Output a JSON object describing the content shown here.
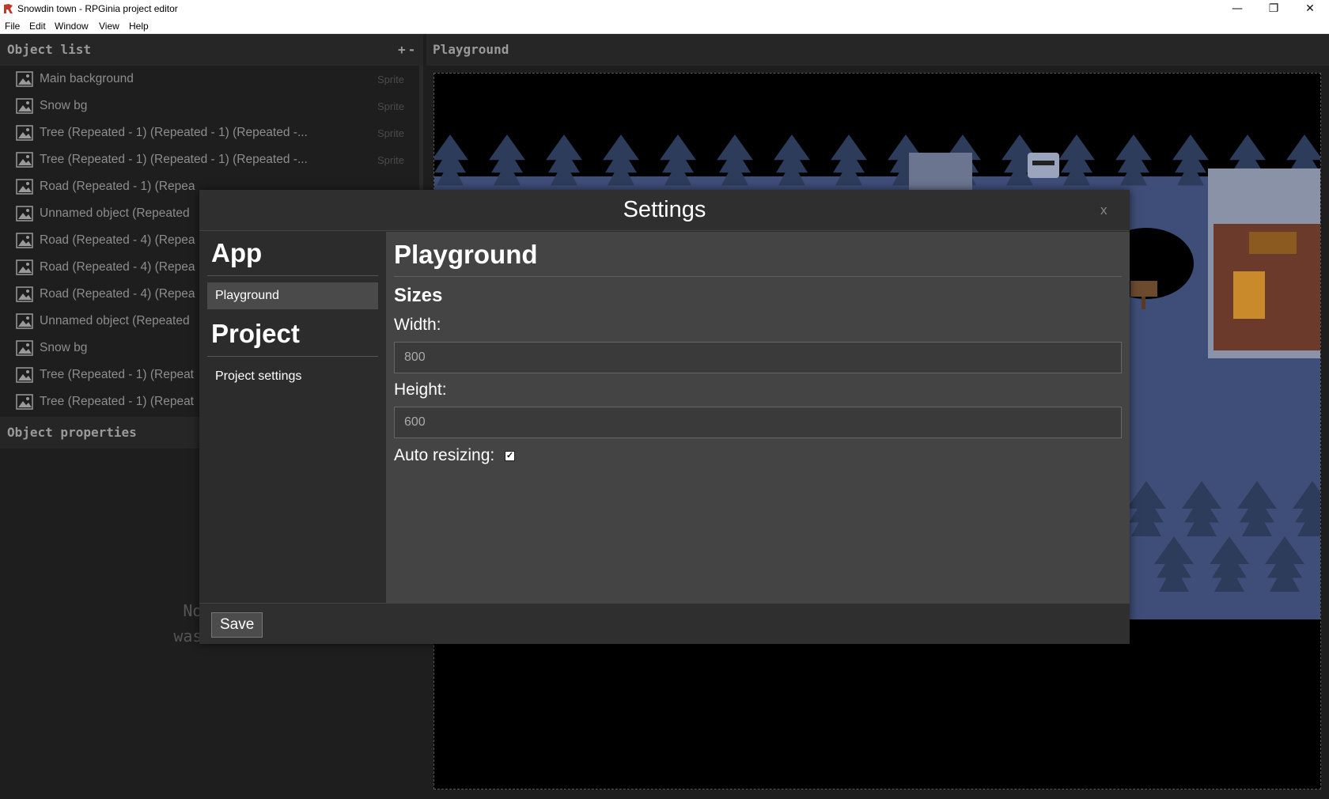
{
  "window": {
    "title": "Snowdin town - RPGinia project editor",
    "minimize_glyph": "—",
    "restore_glyph": "❐",
    "close_glyph": "✕"
  },
  "menubar": {
    "items": [
      "File",
      "Edit",
      "Window",
      "View",
      "Help"
    ]
  },
  "object_list": {
    "title": "Object list",
    "add_label": "+",
    "remove_label": "-",
    "items": [
      {
        "name": "Main background",
        "type": "Sprite"
      },
      {
        "name": "Snow bg",
        "type": "Sprite"
      },
      {
        "name": "Tree (Repeated - 1) (Repeated - 1) (Repeated -...",
        "type": "Sprite"
      },
      {
        "name": "Tree (Repeated - 1) (Repeated - 1) (Repeated -...",
        "type": "Sprite"
      },
      {
        "name": "Road (Repeated - 1) (Repea",
        "type": ""
      },
      {
        "name": "Unnamed object (Repeated",
        "type": ""
      },
      {
        "name": "Road (Repeated - 4) (Repea",
        "type": ""
      },
      {
        "name": "Road (Repeated - 4) (Repea",
        "type": ""
      },
      {
        "name": "Road (Repeated - 4) (Repea",
        "type": ""
      },
      {
        "name": "Unnamed object (Repeated",
        "type": ""
      },
      {
        "name": "Snow bg",
        "type": ""
      },
      {
        "name": "Tree (Repeated - 1) (Repeat",
        "type": ""
      },
      {
        "name": "Tree (Repeated - 1) (Repeat",
        "type": ""
      }
    ]
  },
  "object_properties": {
    "title": "Object properties",
    "empty_line1": "No one",
    "empty_line2": "wasn't t"
  },
  "playground": {
    "title": "Playground"
  },
  "settings_modal": {
    "title": "Settings",
    "close_label": "x",
    "sidebar": {
      "app_heading": "App",
      "app_items": [
        "Playground"
      ],
      "project_heading": "Project",
      "project_items": [
        "Project settings"
      ]
    },
    "content": {
      "title": "Playground",
      "section": "Sizes",
      "width_label": "Width:",
      "width_value": "800",
      "height_label": "Height:",
      "height_value": "600",
      "auto_resize_label": "Auto resizing:",
      "auto_resize_checked": true
    },
    "save_label": "Save"
  },
  "colors": {
    "background": "#1e1e1e",
    "panel_header": "#262626",
    "modal_content": "#444444",
    "snow": "#3e4e78",
    "tree": "#2e3c5c"
  }
}
